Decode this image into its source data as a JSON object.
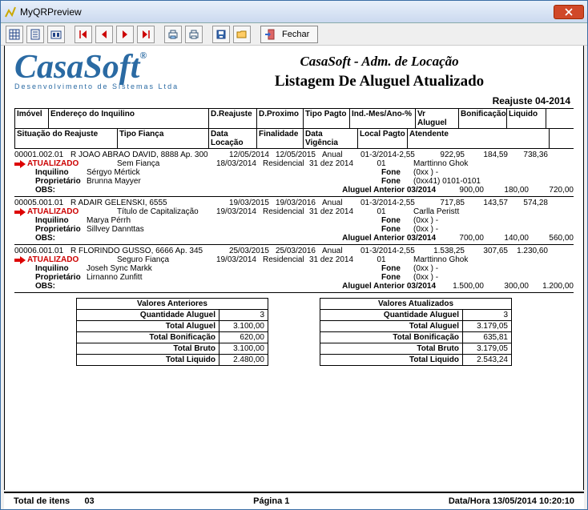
{
  "window": {
    "title": "MyQRPreview"
  },
  "toolbar": {
    "fechar_label": "Fechar"
  },
  "header": {
    "logo_main": "CasaSoft",
    "logo_sub": "Desenvolvimento de Sistemas Ltda",
    "company": "CasaSoft - Adm. de Locação",
    "report_title": "Listagem De Aluguel Atualizado",
    "reajuste": "Reajuste 04-2014"
  },
  "columns1": {
    "imovel": "Imóvel",
    "endereco": "Endereço do Inquilino",
    "dreajuste": "D.Reajuste",
    "dproximo": "D.Proximo",
    "tipopagto": "Tipo Pagto",
    "ind": "Ind.-Mes/Ano-%",
    "vr": "Vr Aluguel",
    "bon": "Bonificação",
    "liq": "Liquido"
  },
  "columns2": {
    "sit": "Situação do Reajuste",
    "tipofianca": "Tipo Fiança",
    "dataloc": "Data Locação",
    "finalidade": "Finalidade",
    "vigencia": "Data Vigência",
    "localpagto": "Local Pagto",
    "atendente": "Atendente"
  },
  "labels": {
    "inquilino": "Inquilino",
    "proprietario": "Proprietário",
    "obs": "OBS:",
    "fone": "Fone",
    "aluguel_ant": "Aluguel Anterior 03/2014"
  },
  "records": [
    {
      "imovel_cod": "00001.002.01",
      "endereco": "R JOAO ABRAO DAVID, 8888 Ap. 300",
      "dreaj": "12/05/2014",
      "dprox": "12/05/2015",
      "tipo": "Anual",
      "ind": "01-3/2014-2,55",
      "vr": "922,95",
      "bon": "184,59",
      "liq": "738,36",
      "status": "ATUALIZADO",
      "tipofianca": "Sem Fiança",
      "dataloc": "18/03/2014",
      "finalidade": "Residencial",
      "vigencia": "31 dez 2014",
      "localpagto": "01",
      "atendente": "Marttinno Ghok",
      "inquilino": "Sérgyo Mértick",
      "inq_fone": "(0xx  )    -",
      "proprietario": "Brunna Mayyer",
      "prop_fone": "(0xx41) 0101-0101",
      "ant_vr": "900,00",
      "ant_bon": "180,00",
      "ant_liq": "720,00"
    },
    {
      "imovel_cod": "00005.001.01",
      "endereco": "R ADAIR GELENSKI, 6555",
      "dreaj": "19/03/2015",
      "dprox": "19/03/2016",
      "tipo": "Anual",
      "ind": "01-3/2014-2,55",
      "vr": "717,85",
      "bon": "143,57",
      "liq": "574,28",
      "status": "ATUALIZADO",
      "tipofianca": "Título de Capitalização",
      "dataloc": "19/03/2014",
      "finalidade": "Residencial",
      "vigencia": "31 dez 2014",
      "localpagto": "01",
      "atendente": "Carlla Peristt",
      "inquilino": "Marya Pérrh",
      "inq_fone": "(0xx  )    -",
      "proprietario": "Sillvey Dannttas",
      "prop_fone": "(0xx  )    -",
      "ant_vr": "700,00",
      "ant_bon": "140,00",
      "ant_liq": "560,00"
    },
    {
      "imovel_cod": "00006.001.01",
      "endereco": "R FLORINDO GUSSO, 6666 Ap. 345",
      "dreaj": "25/03/2015",
      "dprox": "25/03/2016",
      "tipo": "Anual",
      "ind": "01-3/2014-2,55",
      "vr": "1.538,25",
      "bon": "307,65",
      "liq": "1.230,60",
      "status": "ATUALIZADO",
      "tipofianca": "Seguro Fiança",
      "dataloc": "19/03/2014",
      "finalidade": "Residencial",
      "vigencia": "31 dez 2014",
      "localpagto": "01",
      "atendente": "Marttinno Ghok",
      "inquilino": "Joseh Sync Markk",
      "inq_fone": "(0xx  )    -",
      "proprietario": "Lirnanno Zunfitt",
      "prop_fone": "(0xx  )    -",
      "ant_vr": "1.500,00",
      "ant_bon": "300,00",
      "ant_liq": "1.200,00"
    }
  ],
  "summary": {
    "anteriores": {
      "title": "Valores Anteriores",
      "qtd_l": "Quantidade Aluguel",
      "qtd_v": "3",
      "tot_alug_l": "Total Aluguel",
      "tot_alug_v": "3.100,00",
      "tot_bon_l": "Total Bonificação",
      "tot_bon_v": "620,00",
      "tot_bruto_l": "Total Bruto",
      "tot_bruto_v": "3.100,00",
      "tot_liq_l": "Total Liquido",
      "tot_liq_v": "2.480,00"
    },
    "atualizados": {
      "title": "Valores Atualizados",
      "qtd_l": "Quantidade Aluguel",
      "qtd_v": "3",
      "tot_alug_l": "Total Aluguel",
      "tot_alug_v": "3.179,05",
      "tot_bon_l": "Total Bonificação",
      "tot_bon_v": "635,81",
      "tot_bruto_l": "Total Bruto",
      "tot_bruto_v": "3.179,05",
      "tot_liq_l": "Total Liquido",
      "tot_liq_v": "2.543,24"
    }
  },
  "statusbar": {
    "total_l": "Total de itens",
    "total_v": "03",
    "pagina": "Página 1",
    "data_l": "Data/Hora",
    "data_v": "13/05/2014 10:20:10"
  }
}
